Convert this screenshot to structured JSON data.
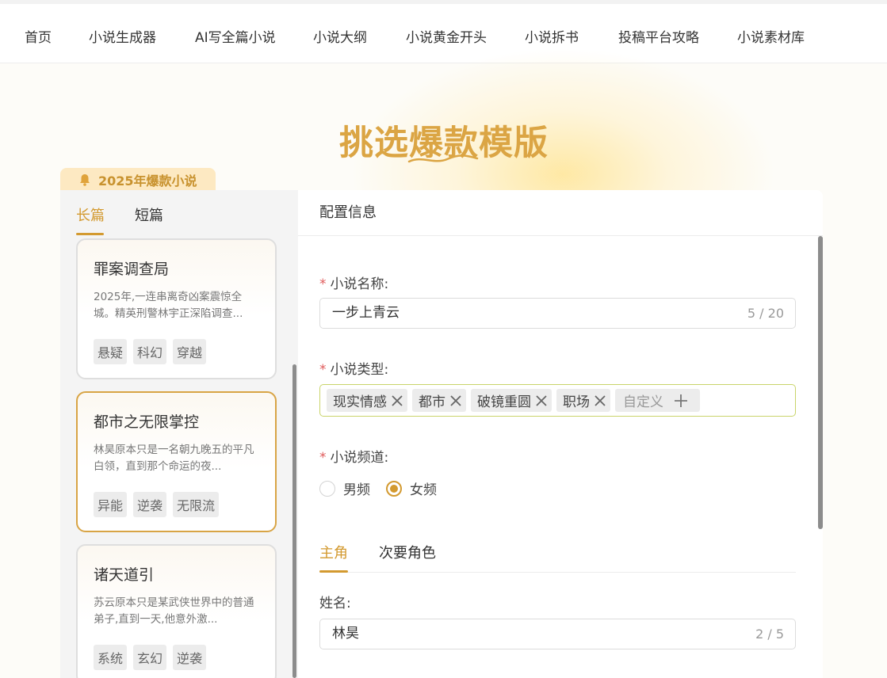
{
  "nav": {
    "items": [
      "首页",
      "小说生成器",
      "AI写全篇小说",
      "小说大纲",
      "小说黄金开头",
      "小说拆书",
      "投稿平台攻略",
      "小说素材库"
    ]
  },
  "hero": {
    "title": "挑选爆款模版"
  },
  "badge": {
    "label": "2025年爆款小说"
  },
  "left_tabs": [
    "长篇",
    "短篇"
  ],
  "cards": [
    {
      "title": "罪案调查局",
      "desc": "2025年,一连串离奇凶案震惊全城。精英刑警林宇正深陷调查...",
      "tags": [
        "悬疑",
        "科幻",
        "穿越"
      ]
    },
    {
      "title": "都市之无限掌控",
      "desc": "林昊原本只是一名朝九晚五的平凡白领，直到那个命运的夜...",
      "tags": [
        "异能",
        "逆袭",
        "无限流"
      ]
    },
    {
      "title": "诸天道引",
      "desc": "苏云原本只是某武侠世界中的普通弟子,直到一天,他意外激...",
      "tags": [
        "系统",
        "玄幻",
        "逆袭"
      ]
    }
  ],
  "config": {
    "header": "配置信息",
    "name_label": "小说名称:",
    "name_value": "一步上青云",
    "name_count": "5 / 20",
    "type_label": "小说类型:",
    "type_tags": [
      "现实情感",
      "都市",
      "破镜重圆",
      "职场"
    ],
    "custom_tag_placeholder": "自定义",
    "channel_label": "小说频道:",
    "channel_options": [
      "男频",
      "女频"
    ],
    "channel_selected": "女频",
    "char_tabs": [
      "主角",
      "次要角色"
    ],
    "char_name_label": "姓名:",
    "char_name_value": "林昊",
    "char_name_count": "2 / 5",
    "required_mark": "*"
  },
  "colors": {
    "accent": "#d39a30",
    "hero_title": "#dba544",
    "required": "#e05c5c"
  }
}
